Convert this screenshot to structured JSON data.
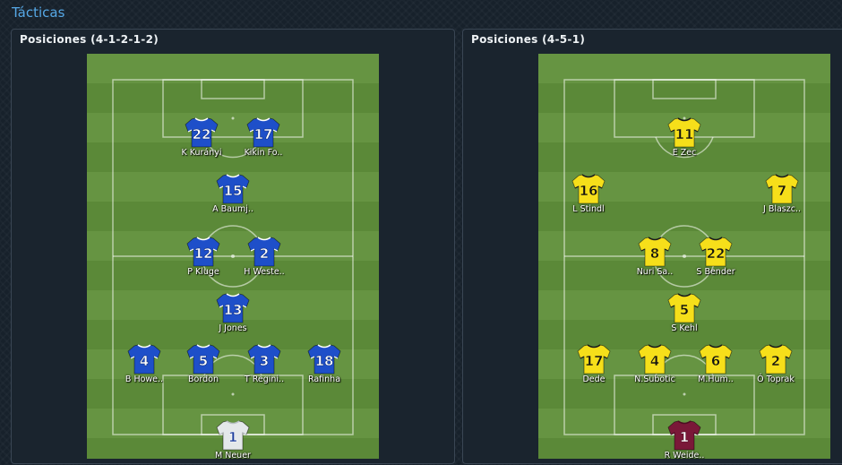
{
  "title": "Tácticas",
  "colors": {
    "title": "#56a8e6",
    "home_kit": "#1e4fc9",
    "home_stripe": "#ffffff",
    "away_kit": "#f6df1a",
    "away_stripe": "#1a1a1a",
    "home_gk": "#e4e8ea",
    "away_gk": "#7a1838"
  },
  "panels": [
    {
      "header": "Posiciones (4-1-2-1-2)",
      "players": [
        {
          "num": "22",
          "name": "K Kurányi",
          "kit": "home",
          "icon": "blue-jersey-icon"
        },
        {
          "num": "17",
          "name": "Kikin Fo..",
          "kit": "home",
          "icon": "blue-jersey-icon"
        },
        {
          "num": "15",
          "name": "A Baumj..",
          "kit": "home",
          "icon": "blue-jersey-icon"
        },
        {
          "num": "12",
          "name": "P Kluge",
          "kit": "home",
          "icon": "blue-jersey-icon"
        },
        {
          "num": "2",
          "name": "H Weste..",
          "kit": "home",
          "icon": "blue-jersey-icon"
        },
        {
          "num": "13",
          "name": "J Jones",
          "kit": "home",
          "icon": "blue-jersey-icon"
        },
        {
          "num": "4",
          "name": "B Howe..",
          "kit": "home",
          "icon": "blue-jersey-icon"
        },
        {
          "num": "5",
          "name": "Bordon",
          "kit": "home",
          "icon": "blue-jersey-icon"
        },
        {
          "num": "3",
          "name": "T Regini..",
          "kit": "home",
          "icon": "blue-jersey-icon"
        },
        {
          "num": "18",
          "name": "Rafinha",
          "kit": "home",
          "icon": "blue-jersey-icon"
        },
        {
          "num": "1",
          "name": "M Neuer",
          "kit": "home_gk",
          "icon": "white-goalkeeper-jersey-icon"
        }
      ]
    },
    {
      "header": "Posiciones (4-5-1)",
      "players": [
        {
          "num": "11",
          "name": "E Zec",
          "kit": "away",
          "icon": "yellow-jersey-icon"
        },
        {
          "num": "16",
          "name": "L Stindl",
          "kit": "away",
          "icon": "yellow-jersey-icon"
        },
        {
          "num": "7",
          "name": "J Blaszc..",
          "kit": "away",
          "icon": "yellow-jersey-icon"
        },
        {
          "num": "8",
          "name": "Nuri Sa..",
          "kit": "away",
          "icon": "yellow-jersey-icon"
        },
        {
          "num": "22",
          "name": "S Bender",
          "kit": "away",
          "icon": "yellow-jersey-icon"
        },
        {
          "num": "5",
          "name": "S Kehl",
          "kit": "away",
          "icon": "yellow-jersey-icon"
        },
        {
          "num": "17",
          "name": "Dede",
          "kit": "away",
          "icon": "yellow-jersey-icon"
        },
        {
          "num": "4",
          "name": "N.Subotic",
          "kit": "away",
          "icon": "yellow-jersey-icon"
        },
        {
          "num": "6",
          "name": "M.Hum..",
          "kit": "away",
          "icon": "yellow-jersey-icon"
        },
        {
          "num": "2",
          "name": "Ó Toprak",
          "kit": "away",
          "icon": "yellow-jersey-icon"
        },
        {
          "num": "1",
          "name": "R Weide..",
          "kit": "away_gk",
          "icon": "maroon-goalkeeper-jersey-icon"
        }
      ]
    }
  ]
}
